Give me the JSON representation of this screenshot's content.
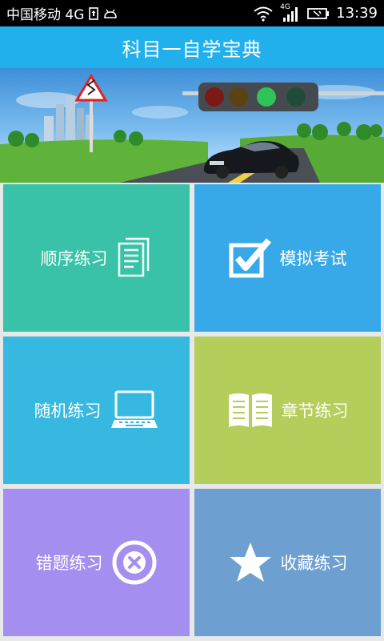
{
  "status_bar": {
    "carrier": "中国移动 4G",
    "network_label": "4G",
    "time": "13:39"
  },
  "title_bar": {
    "title": "科目一自学宝典"
  },
  "menu": [
    {
      "label": "顺序练习",
      "icon": "documents-icon",
      "color": "#39c2a7"
    },
    {
      "label": "模拟考试",
      "icon": "checkbox-icon",
      "color": "#38a9e8"
    },
    {
      "label": "随机练习",
      "icon": "laptop-icon",
      "color": "#37b8e0"
    },
    {
      "label": "章节练习",
      "icon": "book-icon",
      "color": "#b5cd5a"
    },
    {
      "label": "错题练习",
      "icon": "close-circle-icon",
      "color": "#a48ff0"
    },
    {
      "label": "收藏练习",
      "icon": "star-icon",
      "color": "#6d9fd1"
    }
  ]
}
